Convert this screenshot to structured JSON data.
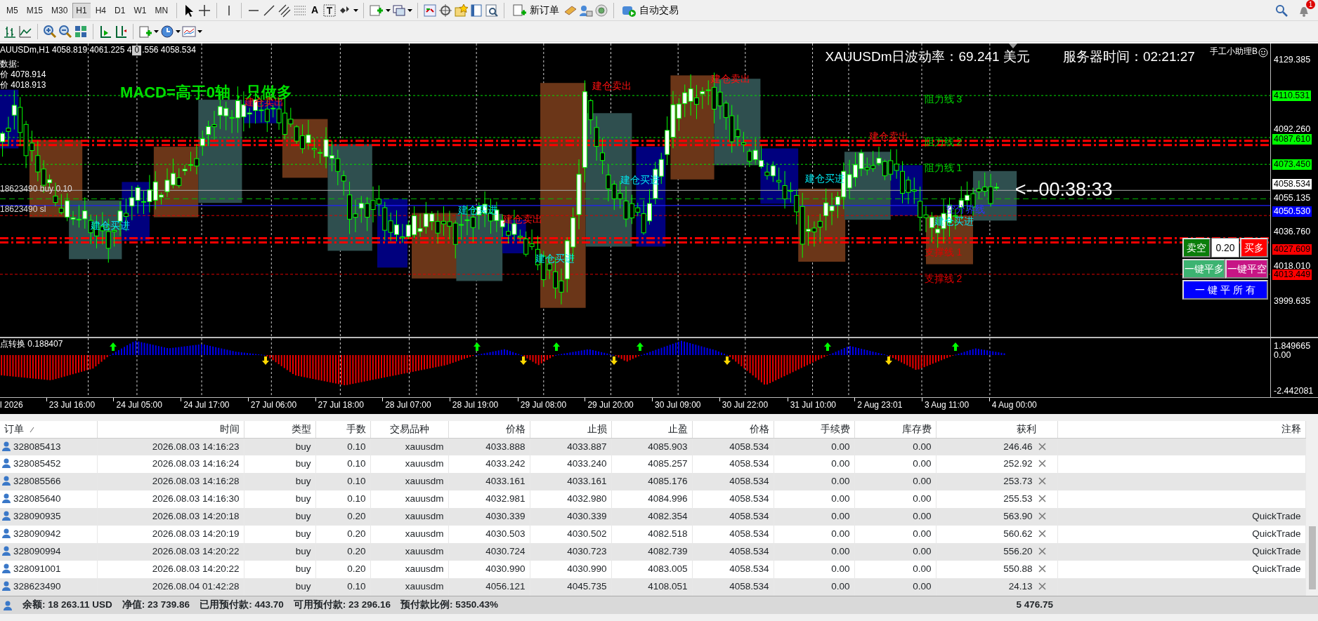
{
  "toolbar": {
    "timeframes": [
      {
        "label": "M5",
        "selected": false
      },
      {
        "label": "M15",
        "selected": false
      },
      {
        "label": "M30",
        "selected": false
      },
      {
        "label": "H1",
        "selected": true
      },
      {
        "label": "H4",
        "selected": false
      },
      {
        "label": "D1",
        "selected": false
      },
      {
        "label": "W1",
        "selected": false
      },
      {
        "label": "MN",
        "selected": false
      }
    ],
    "text_tool": "A",
    "new_order": "新订单",
    "auto_trading": "自动交易",
    "notification_count": "1"
  },
  "chart": {
    "symbol_line": "AUUSDm,H1  4058.819 4061.225 4",
    "cursor_box": "0",
    "symbol_line_end": ".556 4058.534",
    "info_lines": [
      "数据:",
      "价 4078.914",
      "价 4018.913"
    ],
    "order_labels": [
      "18623490 buy 0.10",
      "18623490 sl"
    ],
    "macd_label": "MACD=高于0轴，只做多",
    "volatility": "XAUUSDm日波动率：69.241 美元",
    "server_time": "服务器时间：02:21:27",
    "assistant": "手工小助理B",
    "countdown": "<--00:38:33",
    "level_labels": [
      {
        "text": "阻力线 3",
        "kind": "resistance"
      },
      {
        "text": "阻力线 2",
        "kind": "resistance"
      },
      {
        "text": "阻力线 1",
        "kind": "resistance"
      },
      {
        "text": "空分界线",
        "kind": "pivot"
      },
      {
        "text": "支撑线 1",
        "kind": "support"
      },
      {
        "text": "支撑线 2",
        "kind": "support"
      }
    ],
    "zone_labels": [
      {
        "text": "建仓卖出",
        "kind": "sell"
      },
      {
        "text": "建仓卖出",
        "kind": "sell"
      },
      {
        "text": "建仓卖出",
        "kind": "sell"
      },
      {
        "text": "建仓卖出",
        "kind": "sell"
      },
      {
        "text": "建仓卖出",
        "kind": "sell"
      },
      {
        "text": "建仓买进",
        "kind": "buy"
      },
      {
        "text": "建仓买进",
        "kind": "buy"
      },
      {
        "text": "建仓买进",
        "kind": "buy"
      },
      {
        "text": "建仓买进",
        "kind": "buy"
      },
      {
        "text": "建仓买进",
        "kind": "buy"
      },
      {
        "text": "建仓买进",
        "kind": "buy"
      }
    ],
    "price_axis": [
      {
        "label": "4129.385"
      },
      {
        "label": "4110.531",
        "color": "#00ff00"
      },
      {
        "label": "4092.260"
      },
      {
        "label": "4087.610",
        "color": "#00ff00"
      },
      {
        "label": "4073.450",
        "color": "#00ff00"
      },
      {
        "label": "4058.534",
        "color": "#ffffff"
      },
      {
        "label": "4055.135"
      },
      {
        "label": "4050.530",
        "color": "#0000ff"
      },
      {
        "label": "4036.760"
      },
      {
        "label": "4027.609",
        "color": "#ff0000"
      },
      {
        "label": "4018.010"
      },
      {
        "label": "4013.449",
        "color": "#ff0000"
      },
      {
        "label": "3999.635"
      }
    ],
    "trade_panel": {
      "sell": "卖空",
      "lots": "0.20",
      "buy": "买多",
      "close_buys": "一键平多",
      "close_sells": "一键平空",
      "close_all": "一 键 平 所 有"
    }
  },
  "indicator": {
    "label": "点转换 0.188407",
    "axis": [
      "1.849665",
      "0.00",
      "-2.442081"
    ]
  },
  "time_axis": [
    "l 2026",
    "23 Jul 16:00",
    "24 Jul 05:00",
    "24 Jul 17:00",
    "27 Jul 06:00",
    "27 Jul 18:00",
    "28 Jul 07:00",
    "28 Jul 19:00",
    "29 Jul 08:00",
    "29 Jul 20:00",
    "30 Jul 09:00",
    "30 Jul 22:00",
    "31 Jul 10:00",
    "2 Aug 23:01",
    "3 Aug 11:00",
    "4 Aug 00:00"
  ],
  "table": {
    "columns": [
      "订单",
      "时间",
      "类型",
      "手数",
      "交易品种",
      "价格",
      "止损",
      "止盈",
      "价格",
      "手续费",
      "库存费",
      "获利",
      "注释"
    ],
    "rows": [
      {
        "order": "328085413",
        "time": "2026.08.03 14:16:23",
        "type": "buy",
        "lots": "0.10",
        "symbol": "xauusdm",
        "price": "4033.888",
        "sl": "4033.887",
        "tp": "4085.903",
        "current": "4058.534",
        "commission": "0.00",
        "swap": "0.00",
        "profit": "246.46"
      },
      {
        "order": "328085452",
        "time": "2026.08.03 14:16:24",
        "type": "buy",
        "lots": "0.10",
        "symbol": "xauusdm",
        "price": "4033.242",
        "sl": "4033.240",
        "tp": "4085.257",
        "current": "4058.534",
        "commission": "0.00",
        "swap": "0.00",
        "profit": "252.92"
      },
      {
        "order": "328085566",
        "time": "2026.08.03 14:16:28",
        "type": "buy",
        "lots": "0.10",
        "symbol": "xauusdm",
        "price": "4033.161",
        "sl": "4033.161",
        "tp": "4085.176",
        "current": "4058.534",
        "commission": "0.00",
        "swap": "0.00",
        "profit": "253.73"
      },
      {
        "order": "328085640",
        "time": "2026.08.03 14:16:30",
        "type": "buy",
        "lots": "0.10",
        "symbol": "xauusdm",
        "price": "4032.981",
        "sl": "4032.980",
        "tp": "4084.996",
        "current": "4058.534",
        "commission": "0.00",
        "swap": "0.00",
        "profit": "255.53"
      },
      {
        "order": "328090935",
        "time": "2026.08.03 14:20:18",
        "type": "buy",
        "lots": "0.20",
        "symbol": "xauusdm",
        "price": "4030.339",
        "sl": "4030.339",
        "tp": "4082.354",
        "current": "4058.534",
        "commission": "0.00",
        "swap": "0.00",
        "profit": "563.90",
        "comment": "QuickTrade"
      },
      {
        "order": "328090942",
        "time": "2026.08.03 14:20:19",
        "type": "buy",
        "lots": "0.20",
        "symbol": "xauusdm",
        "price": "4030.503",
        "sl": "4030.502",
        "tp": "4082.518",
        "current": "4058.534",
        "commission": "0.00",
        "swap": "0.00",
        "profit": "560.62",
        "comment": "QuickTrade"
      },
      {
        "order": "328090994",
        "time": "2026.08.03 14:20:22",
        "type": "buy",
        "lots": "0.20",
        "symbol": "xauusdm",
        "price": "4030.724",
        "sl": "4030.723",
        "tp": "4082.739",
        "current": "4058.534",
        "commission": "0.00",
        "swap": "0.00",
        "profit": "556.20",
        "comment": "QuickTrade"
      },
      {
        "order": "328091001",
        "time": "2026.08.03 14:20:22",
        "type": "buy",
        "lots": "0.20",
        "symbol": "xauusdm",
        "price": "4030.990",
        "sl": "4030.990",
        "tp": "4083.005",
        "current": "4058.534",
        "commission": "0.00",
        "swap": "0.00",
        "profit": "550.88",
        "comment": "QuickTrade"
      },
      {
        "order": "328623490",
        "time": "2026.08.04 01:42:28",
        "type": "buy",
        "lots": "0.10",
        "symbol": "xauusdm",
        "price": "4056.121",
        "sl": "4045.735",
        "tp": "4108.051",
        "current": "4058.534",
        "commission": "0.00",
        "swap": "0.00",
        "profit": "24.13"
      }
    ],
    "summary": [
      "余额: 18 263.11 USD",
      "净值: 23 739.86",
      "已用预付款: 443.70",
      "可用预付款: 23 296.16",
      "预付款比例: 5350.43%"
    ],
    "total_profit": "5 476.75"
  }
}
